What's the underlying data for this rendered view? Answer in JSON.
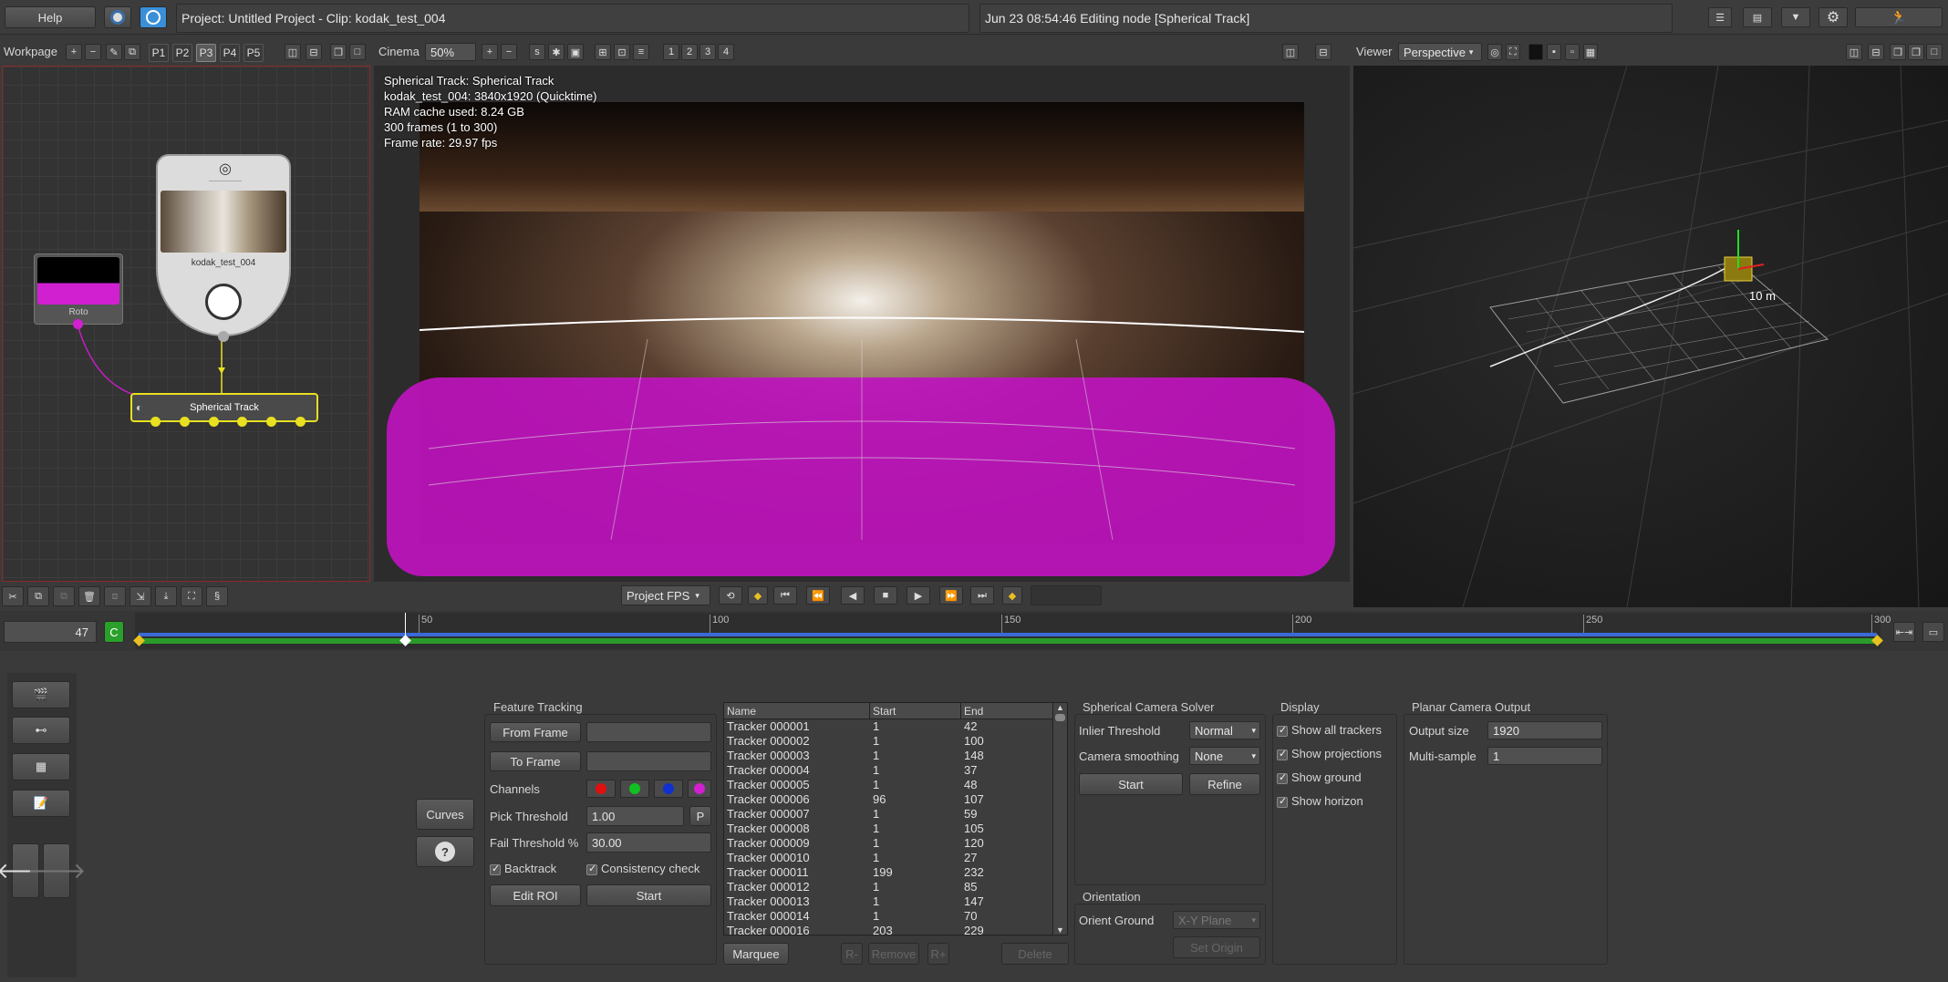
{
  "topbar": {
    "help": "Help",
    "project_title": "Project: Untitled Project - Clip: kodak_test_004",
    "status": "Jun 23 08:54:46 Editing node [Spherical Track]"
  },
  "workpage": {
    "label": "Workpage",
    "tabs": [
      "P1",
      "P2",
      "P3",
      "P4",
      "P5"
    ],
    "active_tab": "P3"
  },
  "cinema": {
    "label": "Cinema",
    "zoom": "50%",
    "num_buttons": [
      "1",
      "2",
      "3",
      "4"
    ],
    "overlay": [
      "Spherical Track: Spherical Track",
      "kodak_test_004: 3840x1920 (Quicktime)",
      "RAM cache used: 8.24 GB",
      "300 frames (1 to 300)",
      "Frame rate: 29.97 fps"
    ],
    "fps_select": "Project FPS"
  },
  "viewer": {
    "label": "Viewer",
    "mode": "Perspective",
    "distance_label": "10 m"
  },
  "nodes": {
    "roto": "Roto",
    "clip": "kodak_test_004",
    "track": "Spherical Track"
  },
  "timeline": {
    "current_frame": "47",
    "cache_btn": "C",
    "ticks": [
      "50",
      "100",
      "150",
      "200",
      "250",
      "300"
    ],
    "frame_start": 1,
    "frame_end": 300,
    "playhead_frame": 47
  },
  "feature_tracking": {
    "title": "Feature Tracking",
    "from_frame": "From Frame",
    "to_frame": "To Frame",
    "channels": "Channels",
    "channel_colors": [
      "#e01010",
      "#10c020",
      "#1030d0",
      "#d020d0"
    ],
    "pick_threshold_label": "Pick Threshold",
    "pick_threshold": "1.00",
    "pick_btn": "P",
    "fail_threshold_label": "Fail Threshold %",
    "fail_threshold": "30.00",
    "backtrack": "Backtrack",
    "consistency": "Consistency check",
    "edit_roi": "Edit ROI",
    "start": "Start"
  },
  "side_buttons": {
    "curves": "Curves",
    "help": "?"
  },
  "tracker_table": {
    "headers": [
      "Name",
      "Start",
      "End"
    ],
    "rows": [
      [
        "Tracker 000001",
        "1",
        "42"
      ],
      [
        "Tracker 000002",
        "1",
        "100"
      ],
      [
        "Tracker 000003",
        "1",
        "148"
      ],
      [
        "Tracker 000004",
        "1",
        "37"
      ],
      [
        "Tracker 000005",
        "1",
        "48"
      ],
      [
        "Tracker 000006",
        "96",
        "107"
      ],
      [
        "Tracker 000007",
        "1",
        "59"
      ],
      [
        "Tracker 000008",
        "1",
        "105"
      ],
      [
        "Tracker 000009",
        "1",
        "120"
      ],
      [
        "Tracker 000010",
        "1",
        "27"
      ],
      [
        "Tracker 000011",
        "199",
        "232"
      ],
      [
        "Tracker 000012",
        "1",
        "85"
      ],
      [
        "Tracker 000013",
        "1",
        "147"
      ],
      [
        "Tracker 000014",
        "1",
        "70"
      ],
      [
        "Tracker 000016",
        "203",
        "229"
      ]
    ],
    "marquee": "Marquee",
    "r_minus": "R-",
    "remove": "Remove",
    "r_plus": "R+",
    "delete": "Delete"
  },
  "solver": {
    "title": "Spherical Camera Solver",
    "inlier_label": "Inlier Threshold",
    "inlier": "Normal",
    "smoothing_label": "Camera smoothing",
    "smoothing": "None",
    "start": "Start",
    "refine": "Refine"
  },
  "orientation": {
    "title": "Orientation",
    "orient_ground": "Orient Ground",
    "plane": "X-Y Plane",
    "set_origin": "Set Origin"
  },
  "display": {
    "title": "Display",
    "items": [
      "Show all trackers",
      "Show projections",
      "Show ground",
      "Show horizon"
    ]
  },
  "planar": {
    "title": "Planar Camera Output",
    "output_size_label": "Output size",
    "output_size": "1920",
    "multisample_label": "Multi-sample",
    "multisample": "1"
  }
}
